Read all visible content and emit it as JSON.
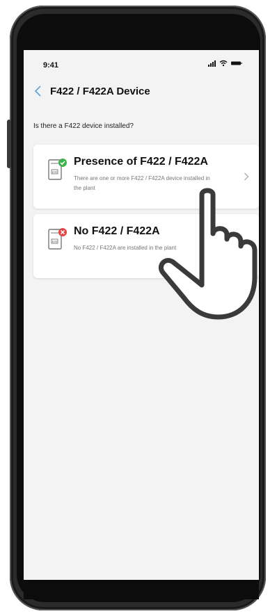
{
  "status_bar": {
    "time": "9:41"
  },
  "header": {
    "title": "F422 / F422A Device"
  },
  "question": "Is there a F422 device installed?",
  "options": [
    {
      "title": "Presence of F422 / F422A",
      "description": "There are one or more F422 / F422A device installed in the plant",
      "status_icon": "check-icon",
      "status_color": "#3cb44b"
    },
    {
      "title": "No F422 / F422A",
      "description": "No F422 / F422A are installed in the plant",
      "status_icon": "cross-icon",
      "status_color": "#e04848"
    }
  ]
}
